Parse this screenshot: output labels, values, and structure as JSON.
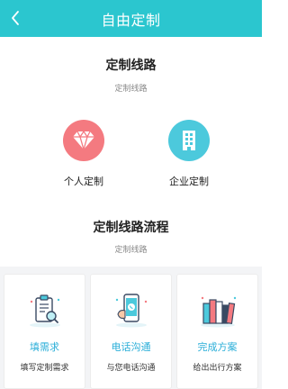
{
  "header": {
    "title": "自由定制"
  },
  "section1": {
    "title": "定制线路",
    "subtitle": "定制线路",
    "options": [
      {
        "label": "个人定制",
        "icon": "diamond-icon",
        "color": "#f47a80"
      },
      {
        "label": "企业定制",
        "icon": "building-icon",
        "color": "#4cc9dc"
      }
    ]
  },
  "section2": {
    "title": "定制线路流程",
    "subtitle": "定制线路",
    "steps": [
      {
        "title": "填需求",
        "desc": "填写定制需求",
        "icon": "clipboard-search-icon"
      },
      {
        "title": "电话沟通",
        "desc": "与您电话沟通",
        "icon": "phone-call-icon"
      },
      {
        "title": "完成方案",
        "desc": "给出出行方案",
        "icon": "books-icon"
      }
    ]
  },
  "colors": {
    "header": "#2bc6cf",
    "accent_text": "#2aaed8"
  }
}
